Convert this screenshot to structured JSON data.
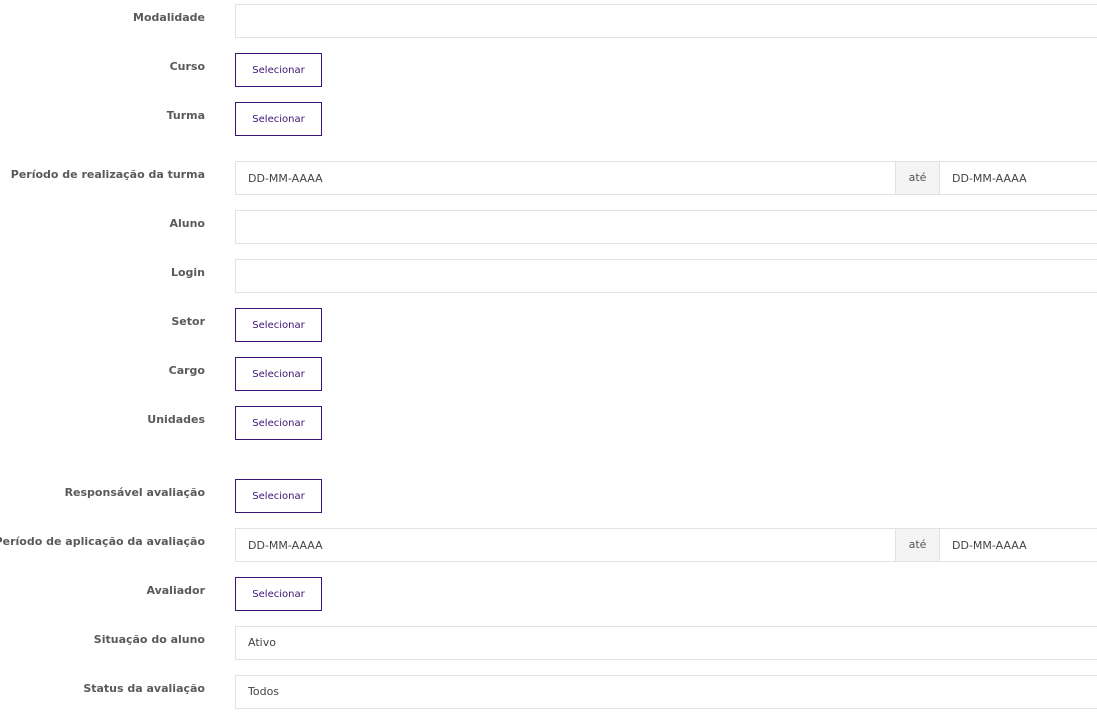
{
  "form": {
    "modalidade": {
      "label": "Modalidade",
      "value": ""
    },
    "curso": {
      "label": "Curso",
      "button": "Selecionar"
    },
    "turma": {
      "label": "Turma",
      "button": "Selecionar"
    },
    "periodo_turma": {
      "label": "Período de realização da turma",
      "start_placeholder": "DD-MM-AAAA",
      "separator": "até",
      "end_placeholder": "DD-MM-AAAA"
    },
    "aluno": {
      "label": "Aluno",
      "value": ""
    },
    "login": {
      "label": "Login",
      "value": ""
    },
    "setor": {
      "label": "Setor",
      "button": "Selecionar"
    },
    "cargo": {
      "label": "Cargo",
      "button": "Selecionar"
    },
    "unidades": {
      "label": "Unidades",
      "button": "Selecionar"
    },
    "responsavel": {
      "label": "Responsável avaliação",
      "button": "Selecionar"
    },
    "periodo_avaliacao": {
      "label": "Período de aplicação da avaliação",
      "start_placeholder": "DD-MM-AAAA",
      "separator": "até",
      "end_placeholder": "DD-MM-AAAA"
    },
    "avaliador": {
      "label": "Avaliador",
      "button": "Selecionar"
    },
    "situacao": {
      "label": "Situação do aluno",
      "value": "Ativo"
    },
    "status": {
      "label": "Status da avaliação",
      "value": "Todos"
    }
  },
  "colors": {
    "accent": "#3d1475",
    "border": "#e2e2e2",
    "label": "#5a5a5a"
  }
}
